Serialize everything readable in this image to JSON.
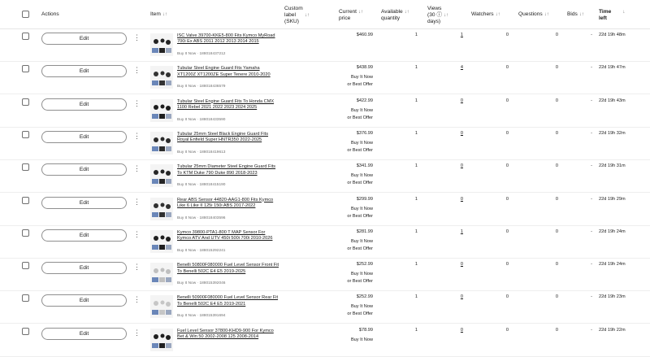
{
  "header": {
    "actions": "Actions",
    "item": "Item",
    "custom_label": [
      "Custom",
      "label",
      "(SKU)"
    ],
    "current_price": [
      "Current",
      "price"
    ],
    "available_quantity": [
      "Available",
      "quantity"
    ],
    "views": [
      "Views",
      "(30 ⓘ",
      "days)"
    ],
    "watchers": "Watchers",
    "questions": "Questions",
    "bids": "Bids",
    "time_left": [
      "Time",
      "left"
    ],
    "sort_glyph": "↓↑",
    "sort_desc_glyph": "↓"
  },
  "rows": [
    {
      "edit": "Edit",
      "title": "ISC Valve 39700-KKE5-800 Fits Kymco MyRoad 700i Ex ABS 2011 2012 2013 2014 2015",
      "listing": "Buy It Now · 188018437212",
      "price": "$460.99",
      "offer": [],
      "qty": "1",
      "views": "1",
      "watchers": "0",
      "questions": "0",
      "bids": "-",
      "time": "22d 19h 48m"
    },
    {
      "edit": "Edit",
      "title": "Tubular Steel Engine Guard Fits Yamaha XT1200Z XT1200ZE Super Tenere 2010-2020",
      "listing": "Buy It Now · 188018436579",
      "price": "$438.99",
      "offer": [
        "Buy It Now",
        "or Best Offer"
      ],
      "qty": "1",
      "views": "4",
      "watchers": "0",
      "questions": "0",
      "bids": "-",
      "time": "22d 19h 47m"
    },
    {
      "edit": "Edit",
      "title": "Tubular Steel Engine Guard Fits To Honda CMX 1100 Rebel 2021 2022 2023 2024 2025",
      "listing": "Buy It Now · 188018433590",
      "price": "$422.99",
      "offer": [
        "Buy It Now",
        "or Best Offer"
      ],
      "qty": "1",
      "views": "0",
      "watchers": "0",
      "questions": "0",
      "bids": "-",
      "time": "22d 19h 43m"
    },
    {
      "edit": "Edit",
      "title": "Tubular 25mm Steel Black Engine Guard Fits Royal Enfield Super HNTR350 2022-2025",
      "listing": "Buy It Now · 188018419613",
      "price": "$376.99",
      "offer": [
        "Buy It Now",
        "or Best Offer"
      ],
      "qty": "1",
      "views": "0",
      "watchers": "0",
      "questions": "0",
      "bids": "-",
      "time": "22d 19h 32m"
    },
    {
      "edit": "Edit",
      "title": "Tubular 25mm Diameter Steel Engine Guard Fits To KTM Duke 790 Duke 890 2018-2023",
      "listing": "Buy It Now · 188018415190",
      "price": "$341.99",
      "offer": [
        "Buy It Now",
        "or Best Offer"
      ],
      "qty": "1",
      "views": "0",
      "watchers": "0",
      "questions": "0",
      "bids": "-",
      "time": "22d 19h 31m"
    },
    {
      "edit": "Edit",
      "title": "Rear ABS Sensor 44820-AAG1-800 Fits Kymco Like 6 Like II 125i 150i ABS 2017-2022",
      "listing": "Buy It Now · 188018403596",
      "price": "$299.99",
      "offer": [
        "Buy It Now",
        "or Best Offer"
      ],
      "qty": "1",
      "views": "0",
      "watchers": "0",
      "questions": "0",
      "bids": "-",
      "time": "22d 19h 29m"
    },
    {
      "edit": "Edit",
      "title": "Kymco 39800-PTA1-800 T MAP Sensor For Kymco ATV And UTV 450i 500i 700i 2010-2026",
      "listing": "Buy It Now · 188015292241",
      "price": "$281.99",
      "offer": [
        "Buy It Now",
        "or Best Offer"
      ],
      "qty": "1",
      "views": "1",
      "watchers": "0",
      "questions": "0",
      "bids": "-",
      "time": "22d 19h 24m"
    },
    {
      "edit": "Edit",
      "title": "Benelli 50800F080000 Fuel Level Sensor Front Fit To Benelli 502C E4 E5 2019-2025",
      "listing": "Buy It Now · 188015392046",
      "price": "$252.99",
      "offer": [
        "Buy It Now",
        "or Best Offer"
      ],
      "qty": "1",
      "views": "0",
      "watchers": "0",
      "questions": "0",
      "bids": "-",
      "time": "22d 19h 24m"
    },
    {
      "edit": "Edit",
      "title": "Benelli 50900F080000 Fuel Level Sensor Rear Fit To Benelli 502C E4 E5 2019-2021",
      "listing": "Buy It Now · 188015391694",
      "price": "$252.99",
      "offer": [
        "Buy It Now",
        "or Best Offer"
      ],
      "qty": "1",
      "views": "0",
      "watchers": "0",
      "questions": "0",
      "bids": "-",
      "time": "22d 19h 23m"
    },
    {
      "edit": "Edit",
      "title": "Fuel Level Sensor 37800-KHD9-900 For Kymco Bet & Win 50 2002-2008 125 2008-2014",
      "listing": "",
      "price": "$78.99",
      "offer": [
        "Buy It Now"
      ],
      "qty": "1",
      "views": "0",
      "watchers": "0",
      "questions": "0",
      "bids": "-",
      "time": "22d 19h 22m"
    }
  ]
}
